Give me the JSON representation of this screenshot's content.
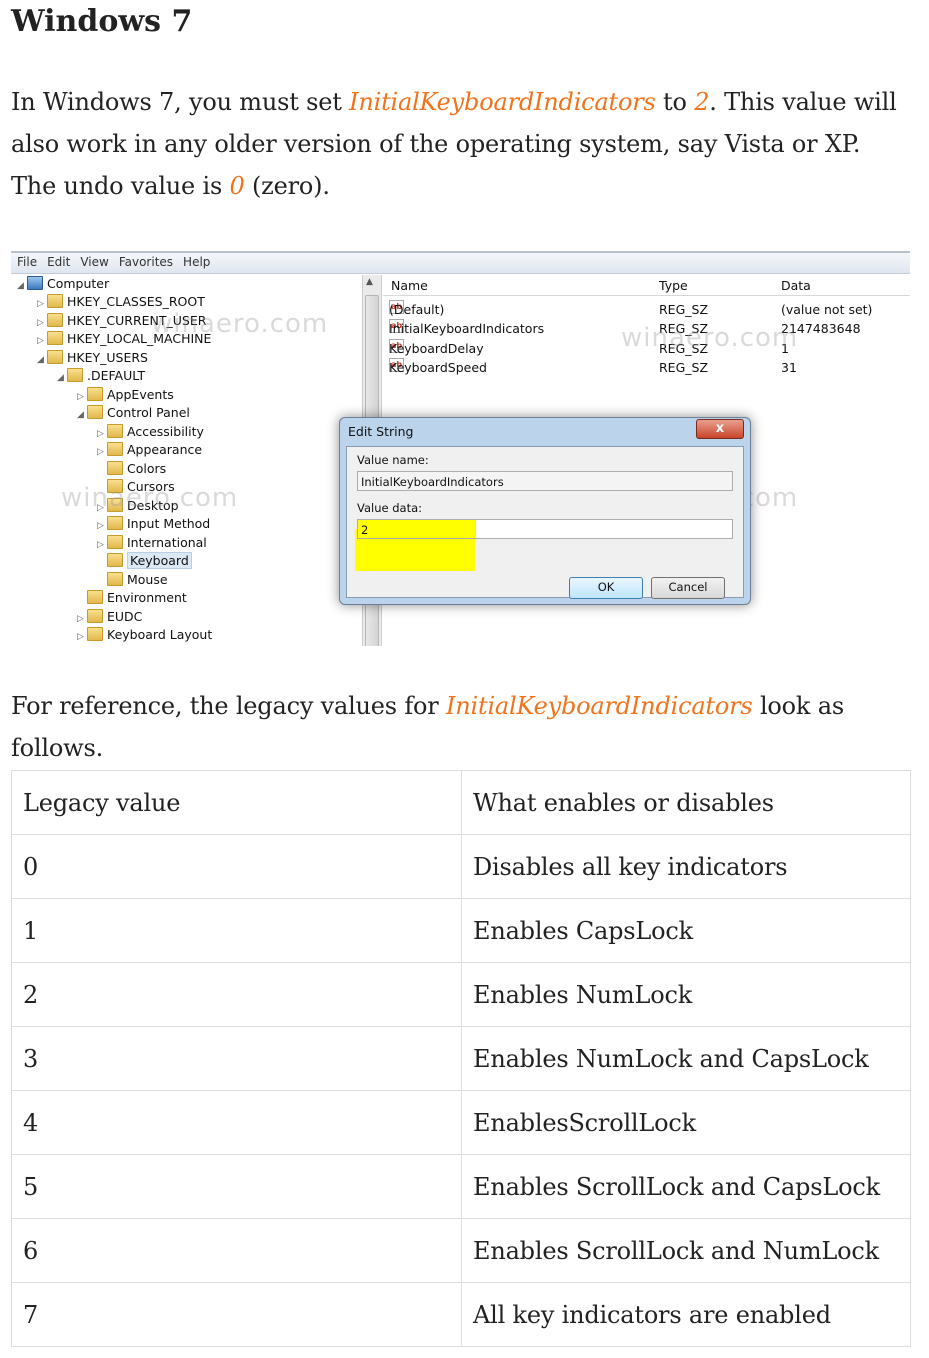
{
  "heading": "Windows 7",
  "intro": {
    "t1": "In Windows 7, you must set ",
    "key": "InitialKeyboardIndicators",
    "t2": " to ",
    "val": "2",
    "t3": ". This value will also work in any older version of the operating system, say Vista or XP. The undo value is ",
    "undo": "0",
    "t4": " (zero)."
  },
  "regedit": {
    "menu": [
      "File",
      "Edit",
      "View",
      "Favorites",
      "Help"
    ],
    "tree": [
      "Computer",
      "HKEY_CLASSES_ROOT",
      "HKEY_CURRENT_USER",
      "HKEY_LOCAL_MACHINE",
      "HKEY_USERS",
      ".DEFAULT",
      "AppEvents",
      "Control Panel",
      "Accessibility",
      "Appearance",
      "Colors",
      "Cursors",
      "Desktop",
      "Input Method",
      "International",
      "Keyboard",
      "Mouse",
      "Environment",
      "EUDC",
      "Keyboard Layout"
    ],
    "columns": {
      "name": "Name",
      "type": "Type",
      "data": "Data"
    },
    "values": [
      {
        "name": "(Default)",
        "type": "REG_SZ",
        "data": "(value not set)"
      },
      {
        "name": "InitialKeyboardIndicators",
        "type": "REG_SZ",
        "data": "2147483648"
      },
      {
        "name": "KeyboardDelay",
        "type": "REG_SZ",
        "data": "1"
      },
      {
        "name": "KeyboardSpeed",
        "type": "REG_SZ",
        "data": "31"
      }
    ],
    "watermark": "winaero.com",
    "dialog": {
      "title": "Edit String",
      "close": "x",
      "value_name_label": "Value name:",
      "value_name": "InitialKeyboardIndicators",
      "value_data_label": "Value data:",
      "value_data": "2",
      "ok": "OK",
      "cancel": "Cancel"
    }
  },
  "reference": {
    "t1": "For reference, the legacy values for ",
    "key": "InitialKeyboardIndicators",
    "t2": " look as follows."
  },
  "table": {
    "headers": [
      "Legacy value",
      "What enables or disables"
    ],
    "rows": [
      [
        "0",
        "Disables all key indicators"
      ],
      [
        "1",
        "Enables CapsLock"
      ],
      [
        "2",
        "Enables NumLock"
      ],
      [
        "3",
        "Enables NumLock and CapsLock"
      ],
      [
        "4",
        "EnablesScrollLock"
      ],
      [
        "5",
        "Enables ScrollLock and CapsLock"
      ],
      [
        "6",
        "Enables ScrollLock and NumLock"
      ],
      [
        "7",
        "All key indicators are enabled"
      ]
    ]
  },
  "colors": {
    "accent": "#f2731a",
    "highlight": "#ffff00"
  }
}
